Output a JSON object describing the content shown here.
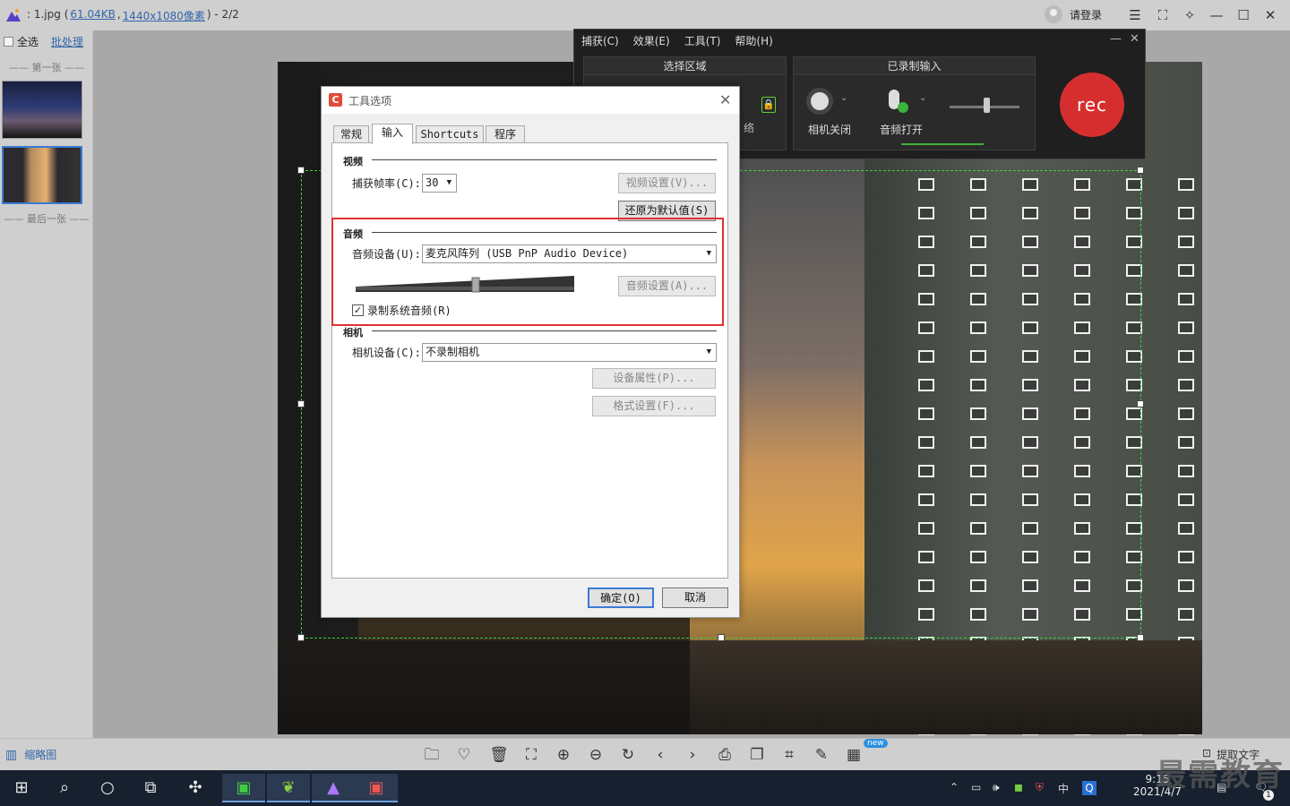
{
  "viewer": {
    "title_prefix": ": 1.jpg (",
    "file_size": "61.04KB",
    "title_sep": ", ",
    "resolution": "1440x1080像素",
    "title_suffix": ") - 2/2",
    "login_label": "请登录"
  },
  "sidebar": {
    "select_all": "全选",
    "batch": "批处理",
    "first_label": "—— 第一张 ——",
    "last_label": "—— 最后一张 ——"
  },
  "recorder": {
    "menu": [
      "捕获(C)",
      "效果(E)",
      "工具(T)",
      "帮助(H)"
    ],
    "select_area_label": "选择区域",
    "recorded_inputs_label": "已录制输入",
    "camera_label": "相机关闭",
    "audio_label": "音频打开",
    "partial_label": "络",
    "rec_label": "rec"
  },
  "dialog": {
    "title": "工具选项",
    "tabs": [
      "常规",
      "输入",
      "Shortcuts",
      "程序"
    ],
    "active_tab": "输入",
    "video": {
      "header": "视频",
      "fps_label": "捕获帧率(C):",
      "fps_value": "30",
      "video_settings": "视频设置(V)...",
      "restore_defaults": "还原为默认值(S)"
    },
    "audio": {
      "header": "音频",
      "device_label": "音频设备(U):",
      "device_value": "麦克风阵列 (USB PnP Audio Device)",
      "audio_settings": "音频设置(A)...",
      "record_system_audio": "录制系统音频(R)",
      "record_system_audio_checked": true,
      "volume_level": 0.55
    },
    "camera": {
      "header": "相机",
      "device_label": "相机设备(C):",
      "device_value": "不录制相机",
      "device_properties": "设备属性(P)...",
      "format_settings": "格式设置(F)..."
    },
    "ok": "确定(O)",
    "cancel": "取消"
  },
  "bottombar": {
    "thumbnails_label": "缩略图",
    "extract_text": "提取文字",
    "new_badge": "new"
  },
  "taskbar": {
    "time": "9:15",
    "date": "2021/4/7",
    "ime": "中",
    "notif_count": "1"
  },
  "watermark": "最需教育",
  "colors": {
    "accent": "#3a7bd5",
    "rec_red": "#d62e2e",
    "highlight_red": "#e03030",
    "selection_green": "#3ccf3c"
  }
}
